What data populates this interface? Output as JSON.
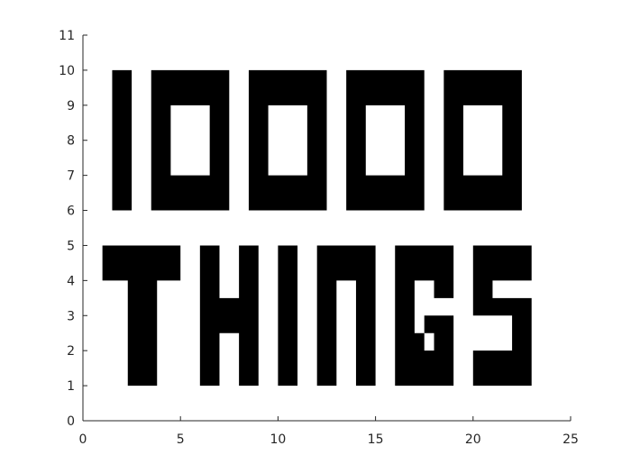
{
  "chart_data": {
    "type": "area",
    "title": "",
    "xlabel": "",
    "ylabel": "",
    "xlim": [
      0,
      25
    ],
    "ylim": [
      0,
      11
    ],
    "xticks": [
      0,
      5,
      10,
      15,
      20,
      25
    ],
    "yticks": [
      0,
      1,
      2,
      3,
      4,
      5,
      6,
      7,
      8,
      9,
      10,
      11
    ],
    "grid": false,
    "legend": "none",
    "fill_color": "#000000",
    "background": "#ffffff",
    "shapes": [
      {
        "name": "glyph-1",
        "points": [
          [
            1.5,
            6
          ],
          [
            2.5,
            6
          ],
          [
            2.5,
            10
          ],
          [
            1.5,
            10
          ]
        ]
      },
      {
        "name": "glyph-0a",
        "points": [
          [
            3.5,
            6
          ],
          [
            7.5,
            6
          ],
          [
            7.5,
            10
          ],
          [
            3.5,
            10
          ]
        ],
        "hole": [
          [
            4.5,
            7
          ],
          [
            6.5,
            7
          ],
          [
            6.5,
            9
          ],
          [
            4.5,
            9
          ]
        ]
      },
      {
        "name": "glyph-0b",
        "points": [
          [
            8.5,
            6
          ],
          [
            12.5,
            6
          ],
          [
            12.5,
            10
          ],
          [
            8.5,
            10
          ]
        ],
        "hole": [
          [
            9.5,
            7
          ],
          [
            11.5,
            7
          ],
          [
            11.5,
            9
          ],
          [
            9.5,
            9
          ]
        ]
      },
      {
        "name": "glyph-0c",
        "points": [
          [
            13.5,
            6
          ],
          [
            17.5,
            6
          ],
          [
            17.5,
            10
          ],
          [
            13.5,
            10
          ]
        ],
        "hole": [
          [
            14.5,
            7
          ],
          [
            16.5,
            7
          ],
          [
            16.5,
            9
          ],
          [
            14.5,
            9
          ]
        ]
      },
      {
        "name": "glyph-0d",
        "points": [
          [
            18.5,
            6
          ],
          [
            22.5,
            6
          ],
          [
            22.5,
            10
          ],
          [
            18.5,
            10
          ]
        ],
        "hole": [
          [
            19.5,
            7
          ],
          [
            21.5,
            7
          ],
          [
            21.5,
            9
          ],
          [
            19.5,
            9
          ]
        ]
      },
      {
        "name": "glyph-T",
        "points": [
          [
            1,
            4
          ],
          [
            2.3,
            4
          ],
          [
            2.3,
            1
          ],
          [
            3.8,
            1
          ],
          [
            3.8,
            4
          ],
          [
            5,
            4
          ],
          [
            5,
            5
          ],
          [
            1,
            5
          ]
        ]
      },
      {
        "name": "glyph-H",
        "points": [
          [
            6,
            1
          ],
          [
            7,
            1
          ],
          [
            7,
            2.5
          ],
          [
            8,
            2.5
          ],
          [
            8,
            1
          ],
          [
            9,
            1
          ],
          [
            9,
            5
          ],
          [
            8,
            5
          ],
          [
            8,
            3.5
          ],
          [
            7,
            3.5
          ],
          [
            7,
            5
          ],
          [
            6,
            5
          ]
        ]
      },
      {
        "name": "glyph-I",
        "points": [
          [
            10,
            1
          ],
          [
            11,
            1
          ],
          [
            11,
            5
          ],
          [
            10,
            5
          ]
        ]
      },
      {
        "name": "glyph-N",
        "points": [
          [
            12,
            1
          ],
          [
            13,
            1
          ],
          [
            13,
            4
          ],
          [
            14,
            4
          ],
          [
            14,
            1
          ],
          [
            15,
            1
          ],
          [
            15,
            5
          ],
          [
            12,
            5
          ]
        ]
      },
      {
        "name": "glyph-G",
        "points": [
          [
            16,
            1
          ],
          [
            19,
            1
          ],
          [
            19,
            3
          ],
          [
            17.5,
            3
          ],
          [
            17.5,
            2
          ],
          [
            18,
            2
          ],
          [
            18,
            2.5
          ],
          [
            17,
            2.5
          ],
          [
            17,
            4
          ],
          [
            18,
            4
          ],
          [
            18,
            3.5
          ],
          [
            19,
            3.5
          ],
          [
            19,
            5
          ],
          [
            16,
            5
          ]
        ]
      },
      {
        "name": "glyph-S",
        "points": [
          [
            20,
            1
          ],
          [
            23,
            1
          ],
          [
            23,
            3.5
          ],
          [
            21,
            3.5
          ],
          [
            21,
            4
          ],
          [
            23,
            4
          ],
          [
            23,
            5
          ],
          [
            20,
            5
          ],
          [
            20,
            3
          ],
          [
            22,
            3
          ],
          [
            22,
            2
          ],
          [
            20,
            2
          ]
        ]
      }
    ]
  }
}
